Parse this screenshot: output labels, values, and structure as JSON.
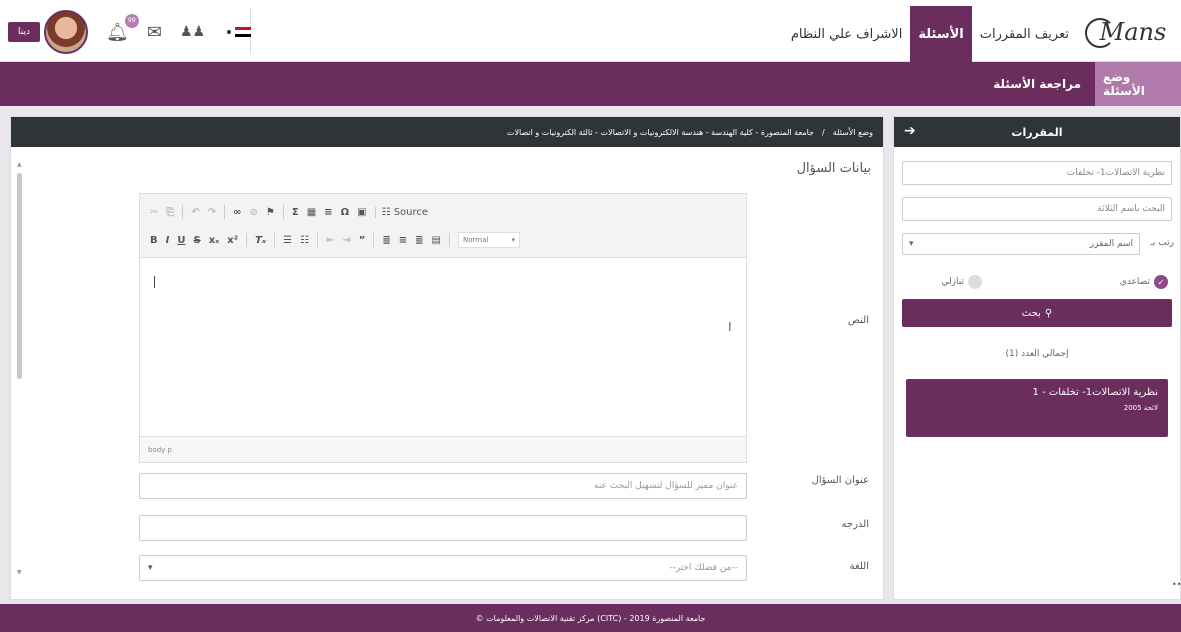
{
  "header": {
    "logo_text": "Mans",
    "nav": [
      "تعريف المقررات",
      "الأسئلة",
      "الاشراف علي النظام"
    ],
    "active_nav": "الأسئلة",
    "user_button": "دينا",
    "notif_count": "99"
  },
  "subnav": {
    "items": [
      "وضع الأسئلة",
      "مراجعة الأسئلة"
    ]
  },
  "side": {
    "title": "المقررات",
    "course_field": "نظرية الاتصالات1- تخلفات",
    "search_placeholder": "البحث باسم الثلاثة",
    "sort_label": "رتب بـ",
    "sort_value": "اسم المقرر",
    "radio_asc": "تصاعدي",
    "radio_desc": "تنازلي",
    "search_button": "بحث",
    "total": "إجمالي العدد (1)",
    "result_title": "1 - نظرية الاتصالات1- تخلفات",
    "result_sub": "لائحة 2005"
  },
  "main": {
    "breadcrumb_root": "وضع الأسئلة",
    "breadcrumb_path": "جامعة المنصورة - كلية الهندسة - هندسة الالكترونيات و الاتصالات - ثالثة الكترونيات و اتصالات",
    "section_title": "بيانات السؤال",
    "label_text": "النص",
    "label_question_title": "عنوان السؤال",
    "question_title_placeholder": "عنوان مميز للسؤال لتسهيل البحث عنه",
    "label_grade": "الدرجه",
    "label_language": "اللغة",
    "language_placeholder": "--من فضلك اختر--",
    "editor": {
      "source_label": "Source",
      "format_label": "Normal",
      "path": "body p"
    }
  },
  "footer": {
    "text": "© مركز تقنية الاتصالات والمعلومات (CITC) - جامعة المنصورة 2019"
  },
  "colors": {
    "brand": "#6b2d5e",
    "brand_light": "#b07aab",
    "dark_bar": "#2f3437"
  }
}
